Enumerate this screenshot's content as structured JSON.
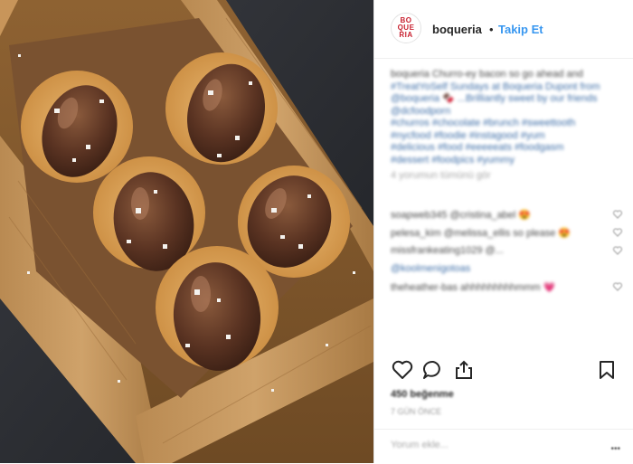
{
  "post": {
    "username": "boqueria",
    "separator": "•",
    "follow_label": "Takip Et",
    "avatar_letters": [
      "BO",
      "QUE",
      "RIA"
    ],
    "brand_color": "#c8202f",
    "link_color": "#3897f0"
  },
  "caption_lines": [
    {
      "text": "boqueria Churro-ey bacon so go ahead and",
      "kind": "text"
    },
    {
      "text": "#TreatYoSelf Sundays at Boqueria Dupont from",
      "kind": "link"
    },
    {
      "text": "@boqueria 🍫 ...Brilliantly sweet by our friends",
      "kind": "link"
    },
    {
      "text": "@dcfoodporn",
      "kind": "link"
    },
    {
      "text": "#churros #chocolate #brunch #sweettooth",
      "kind": "link"
    },
    {
      "text": "#nycfood #foodie #instagood #yum",
      "kind": "link"
    },
    {
      "text": "#delicious #food #eeeeeats #foodgasm",
      "kind": "link"
    },
    {
      "text": "#dessert #foodpics #yummy",
      "kind": "link"
    },
    {
      "text": "4 yorumun tümünü gör",
      "kind": "muted"
    }
  ],
  "comments": [
    {
      "text": "soapweb345 @cristina_abel 😍"
    },
    {
      "text": "pelesa_kim @melissa_ellis so please 😍"
    },
    {
      "text": "missfrankeating1029 @..."
    },
    {
      "text": "@koolmenigotoas"
    },
    {
      "text": "theheather-bas ahhhhhhhhhmmm 💗"
    }
  ],
  "actions": {
    "icons": [
      "heart-icon",
      "comment-icon",
      "share-icon",
      "bookmark-icon"
    ]
  },
  "likes_text": "450 beğenme",
  "time_text": "7 GÜN ÖNCE",
  "comment_placeholder": "Yorum ekle...",
  "more_label": "•••"
}
